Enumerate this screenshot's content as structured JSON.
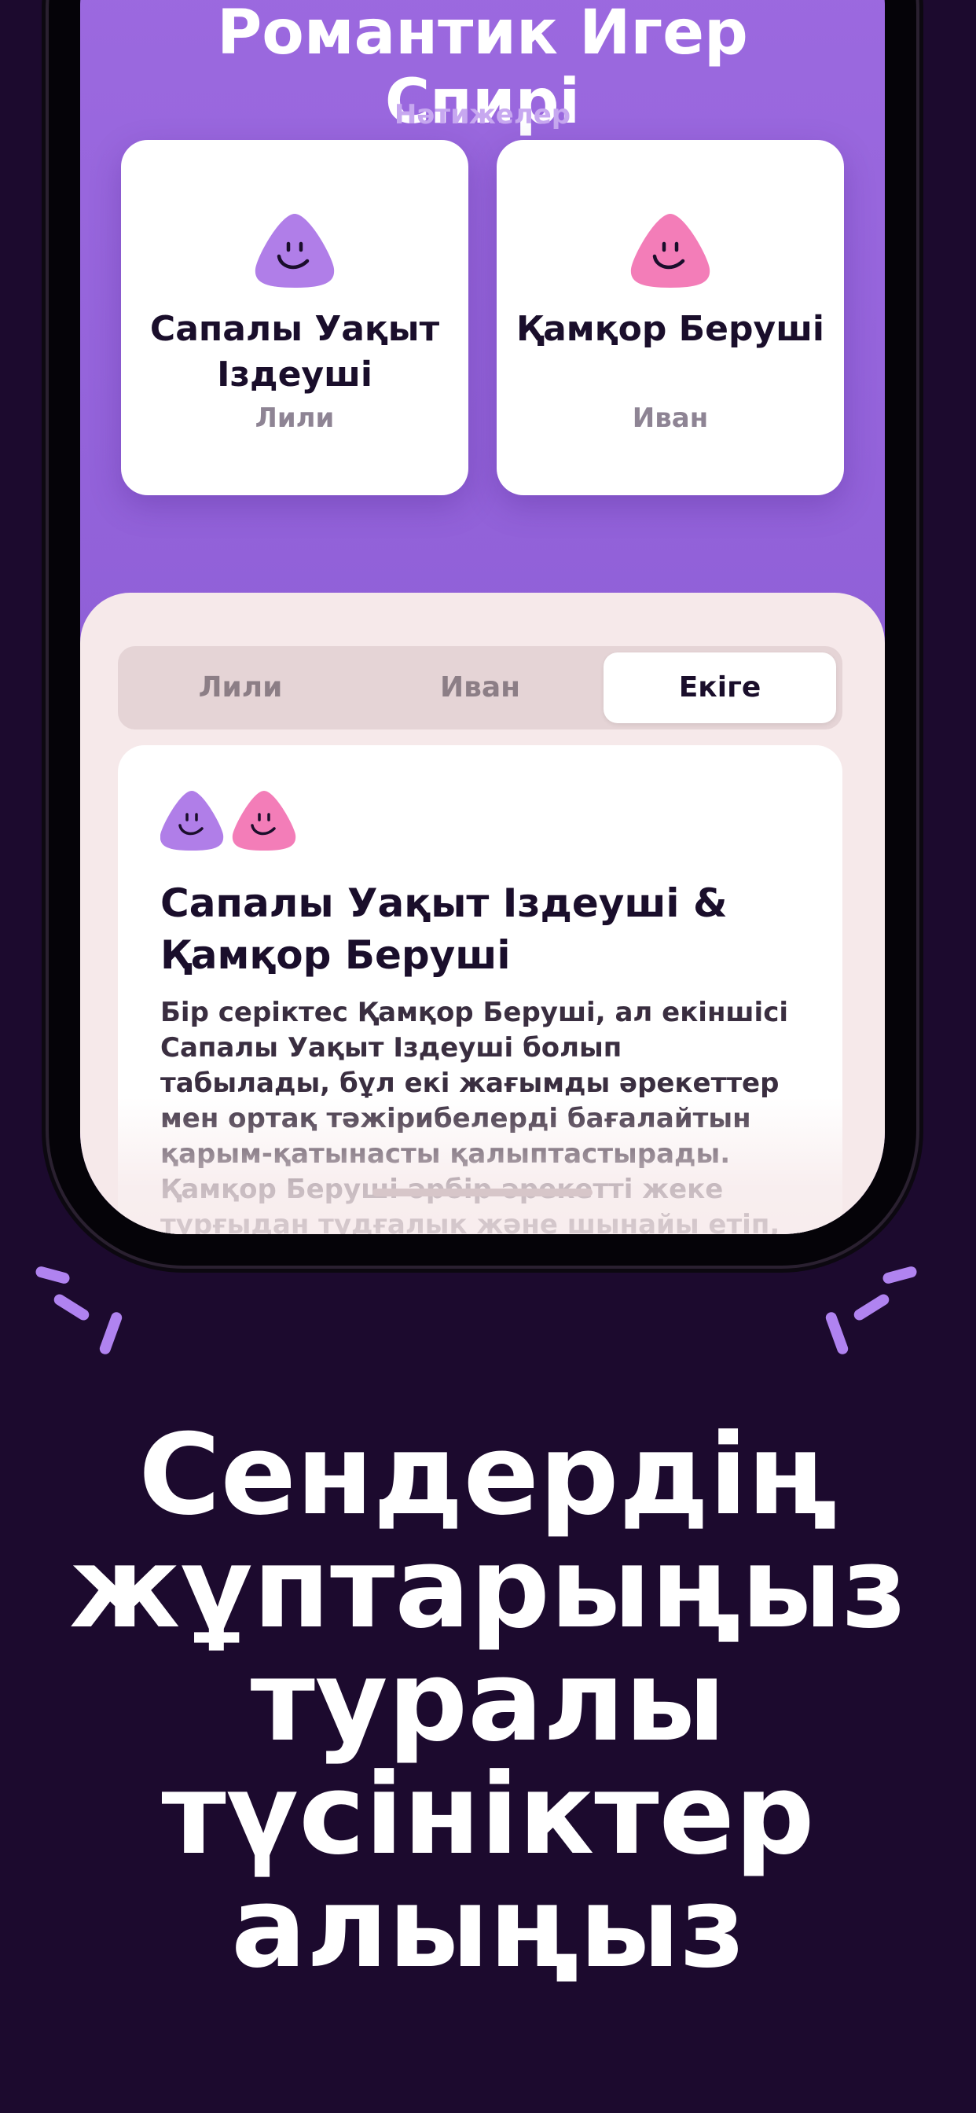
{
  "colors": {
    "background": "#1c0a2e",
    "screen_purple": "#9a67df",
    "sheet": "#f6e9ea",
    "avatar_purple": "#b07ee8",
    "avatar_pink": "#f37db8",
    "text_dark": "#1a0e2b",
    "sparkle": "#b083f0"
  },
  "app": {
    "title_line1": "Романтик Игер",
    "title_line2": "Спирі",
    "subtitle": "Нәтижелер"
  },
  "results": [
    {
      "type": "Сапалы Уақыт Іздеуші",
      "person": "Лили",
      "avatar_icon": "purple-smile-blob-icon"
    },
    {
      "type": "Қамқор Беруші",
      "person": "Иван",
      "avatar_icon": "pink-smile-blob-icon"
    }
  ],
  "tabs": [
    {
      "label": "Лили",
      "active": false
    },
    {
      "label": "Иван",
      "active": false
    },
    {
      "label": "Екіге",
      "active": true
    }
  ],
  "description": {
    "title": "Сапалы Уақыт Іздеуші & Қамқор Беруші",
    "body": "Бір серіктес Қамқор Беруші, ал екіншісі Сапалы Уақыт Іздеуші болып табылады, бұл екі жағымды әрекеттер мен ортақ тәжірибелерді бағалайтын қарым-қатынасты қалыптастырады. Қамқор Беруші әрбір әрекетті жеке тұрғыдан тудғалык және шынайы етіп, Сапалы"
  },
  "headline": "Сендердің жұптарыңыз туралы түсініктер алыңыз"
}
